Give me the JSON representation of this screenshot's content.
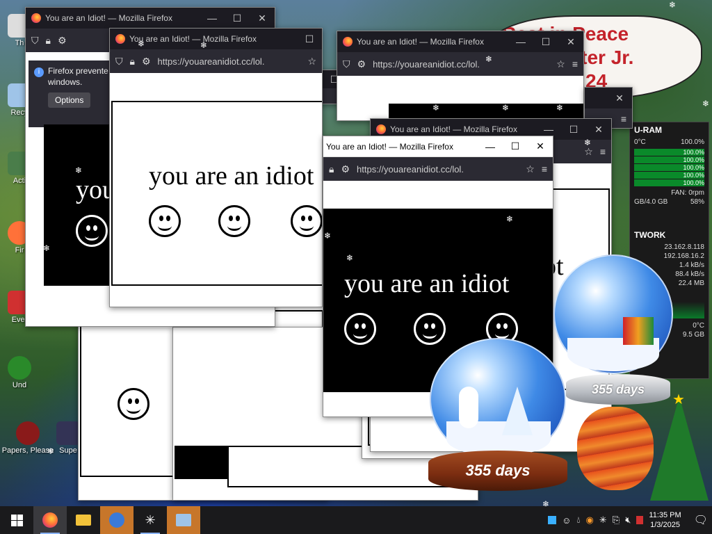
{
  "desktop": {
    "icons": [
      {
        "label": "Th",
        "color": "#dddddd"
      },
      {
        "label": "Recy",
        "color": "#9fc4e8"
      },
      {
        "label": "Acti",
        "color": "#4a7d4a"
      },
      {
        "label": "Fir",
        "color": "#ff7139"
      },
      {
        "label": "Ever",
        "color": "#d03030"
      },
      {
        "label": "Und",
        "color": "#2a8a2a"
      },
      {
        "label": "Papers, Please",
        "color": "#8a1a1a"
      },
      {
        "label": "Supe",
        "color": "#333355"
      }
    ],
    "memorial": {
      "line1": "Rest in Peace",
      "line2": "rl Carter Jr.",
      "line3": "24"
    }
  },
  "windows": {
    "title": "You are an Idiot! — Mozilla Firefox",
    "url": "https://youareanidiot.cc/lol.",
    "message": "you are an idiot",
    "message_overlap": "ot",
    "notify": {
      "line1": "Firefox prevente",
      "line2": "windows.",
      "button": "Options"
    }
  },
  "gadget": {
    "title": "U-RAM",
    "temp_label": "0°C",
    "cpu_total": "100.0%",
    "cores": [
      "100.0%",
      "100.0%",
      "100.0%",
      "100.0%",
      "100.0%"
    ],
    "fan": "FAN: 0rpm",
    "ram_text": "GB/4.0 GB",
    "ram_pct": "58%",
    "net_title": "TWORK",
    "ip_public": "23.162.8.118",
    "ip_local": "192.168.16.2",
    "down": "1.4 kB/s",
    "up": "88.4 kB/s",
    "total": "22.4 MB",
    "temp2": "0°C",
    "disk": "9.5 GB"
  },
  "globes": {
    "big_label": "355 days",
    "small_label": "355 days"
  },
  "taskbar": {
    "start_icon": "windows-logo-icon",
    "apps": [
      "firefox-icon",
      "file-explorer-icon",
      "globe-app-icon",
      "asterisk-app-icon",
      "control-panel-icon"
    ],
    "time": "11:35 PM",
    "date": "1/3/2025"
  }
}
